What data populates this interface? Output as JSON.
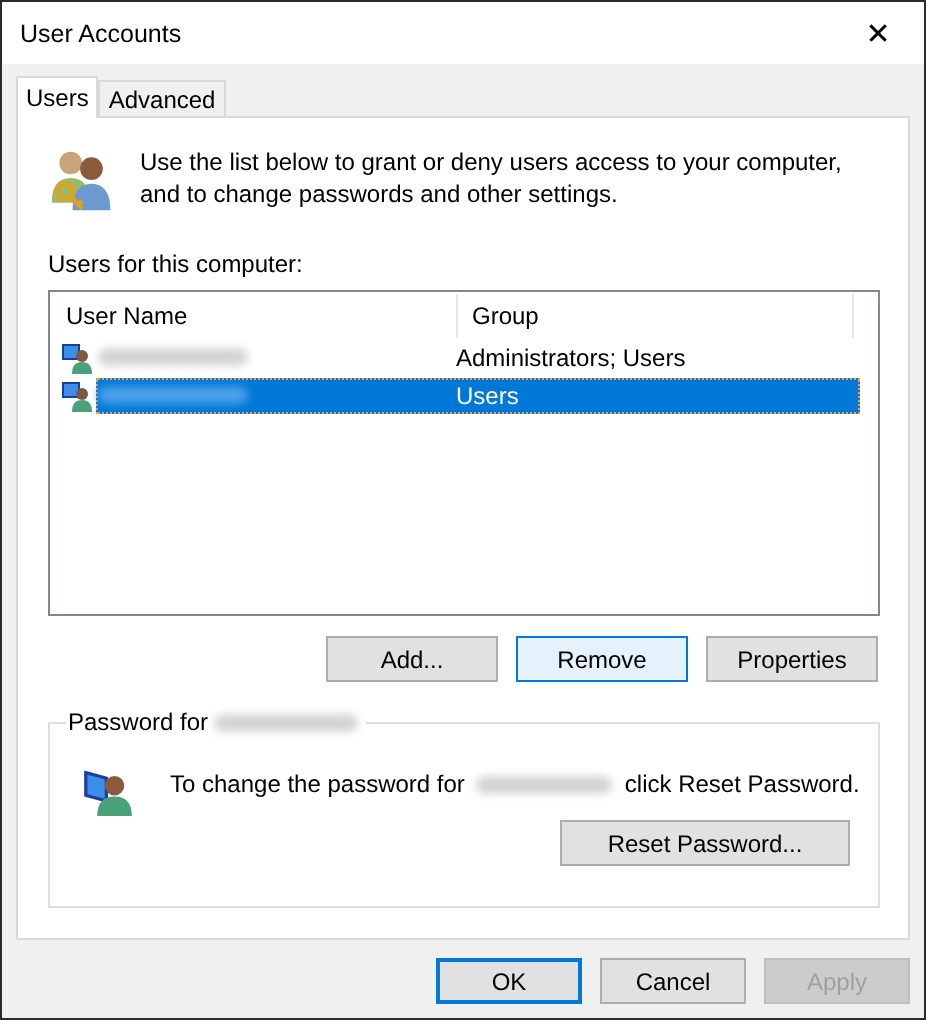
{
  "window": {
    "title": "User Accounts",
    "close": "✕"
  },
  "tabs": [
    {
      "label": "Users",
      "selected": true
    },
    {
      "label": "Advanced",
      "selected": false
    }
  ],
  "intro": "Use the list below to grant or deny users access to your computer, and to change passwords and other settings.",
  "list_label": "Users for this computer:",
  "table": {
    "columns": [
      "User Name",
      "Group"
    ],
    "rows": [
      {
        "group": "Administrators; Users",
        "selected": false
      },
      {
        "group": "Users",
        "selected": true
      }
    ]
  },
  "list_buttons": [
    {
      "label": "Add...",
      "hovered": false
    },
    {
      "label": "Remove",
      "hovered": true
    },
    {
      "label": "Properties",
      "hovered": false
    }
  ],
  "password": {
    "legend": "Password for",
    "text_before": "To change the password for",
    "text_after": "click Reset Password.",
    "button": "Reset Password..."
  },
  "dialog_buttons": [
    {
      "label": "OK",
      "default": true,
      "disabled": false
    },
    {
      "label": "Cancel",
      "default": false,
      "disabled": false
    },
    {
      "label": "Apply",
      "default": false,
      "disabled": true
    }
  ]
}
